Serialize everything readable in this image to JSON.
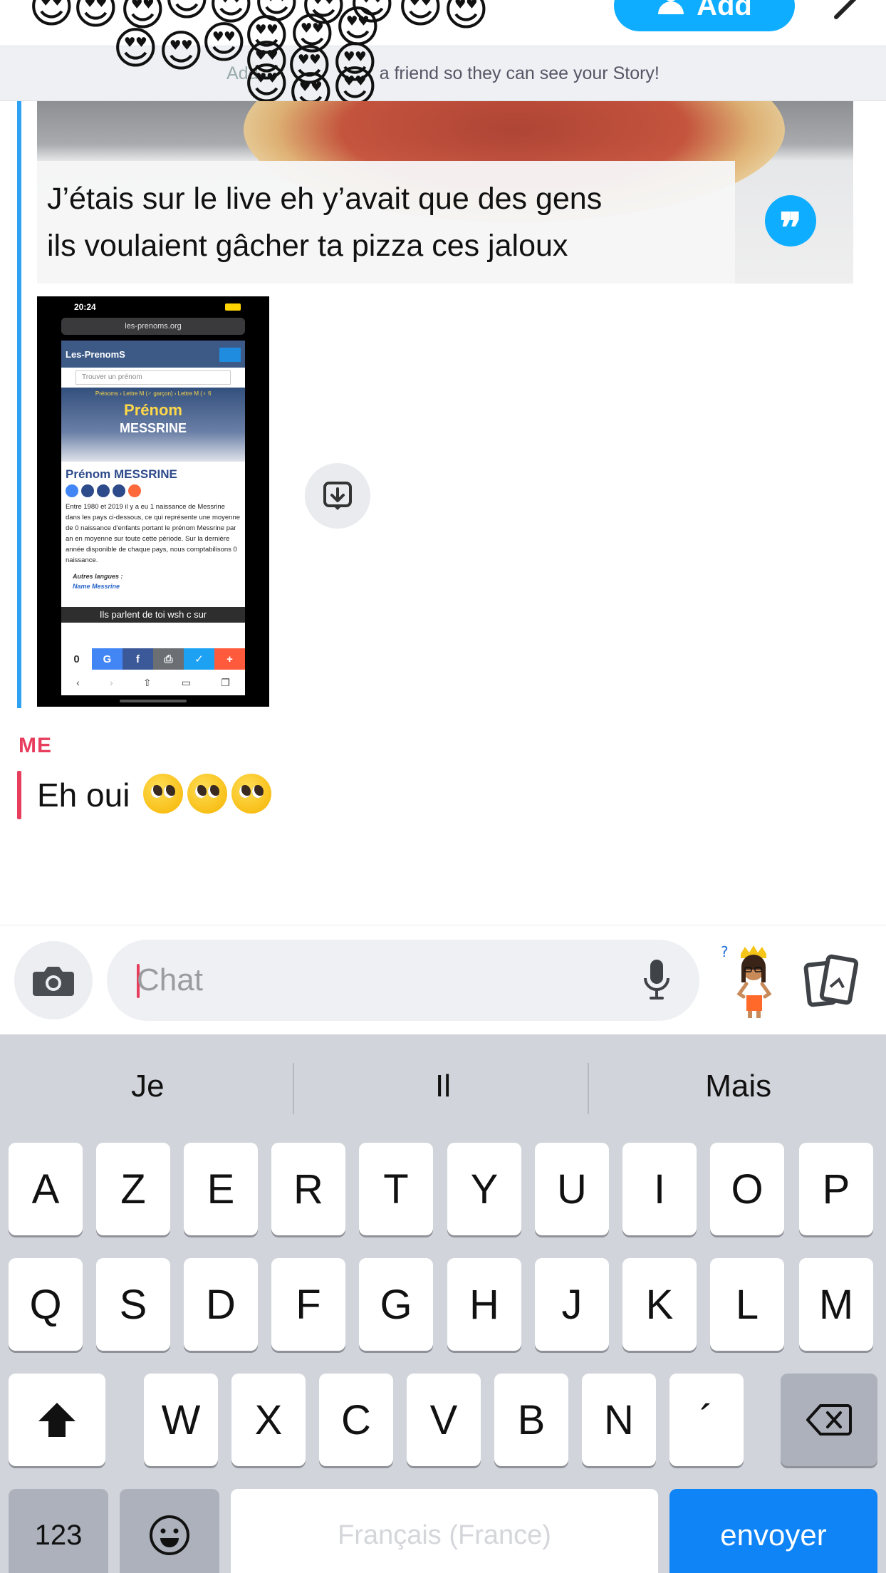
{
  "header": {
    "add_label": "Add",
    "notice": "Add ··· a friend so they can see your Story!",
    "notice_visible": "a friend so they can see your Story!",
    "notice_prefix": "Add",
    "emoji": "😍"
  },
  "thread": {
    "quote": {
      "text_line1": "J’étais sur le live eh y’avait que des gens",
      "text_line2": "ils voulaient gâcher ta pizza ces jaloux"
    },
    "attachment": {
      "status_time": "20:24",
      "url": "les-prenoms.org",
      "site_name": "Les-PrenomS",
      "search_placeholder": "Trouver un prénom",
      "breadcrumb": "Prénoms › Lettre M (♂ garçon) › Lettre M (♀ fi",
      "hero_line1": "Prénom",
      "hero_line2": "MESSRINE",
      "title": "Prénom MESSRINE",
      "body": "Entre 1980 et 2019 il y a eu 1 naissance de Messrine dans les pays ci-dessous, ce qui représente une moyenne de 0 naissance d'enfants portant le prénom Messrine par an en moyenne sur toute cette période. Sur la dernière année disponible de chaque pays, nous comptabilisons 0 naissance.",
      "other_langs": "Autres langues :",
      "other_langs_item": "Name Messrine",
      "caption": "Ils parlent de toi wsh c sur",
      "share_count": "0",
      "share_keys": [
        "G",
        "f",
        "⎙",
        "✓",
        "+"
      ]
    },
    "me_label": "ME",
    "me_text": "Eh oui"
  },
  "composer": {
    "placeholder": "Chat"
  },
  "keyboard": {
    "suggestions": [
      "Je",
      "Il",
      "Mais"
    ],
    "row1": [
      "A",
      "Z",
      "E",
      "R",
      "T",
      "Y",
      "U",
      "I",
      "O",
      "P"
    ],
    "row2": [
      "Q",
      "S",
      "D",
      "F",
      "G",
      "H",
      "J",
      "K",
      "L",
      "M"
    ],
    "row3": [
      "W",
      "X",
      "C",
      "V",
      "B",
      "N",
      "´"
    ],
    "numbers_label": "123",
    "space_label": "Français (France)",
    "send_label": "envoyer"
  },
  "colors": {
    "accent_blue": "#0fadff",
    "friend_bar": "#2ea2f0",
    "me_red": "#e83e5e",
    "send_key": "#0f84f6"
  }
}
